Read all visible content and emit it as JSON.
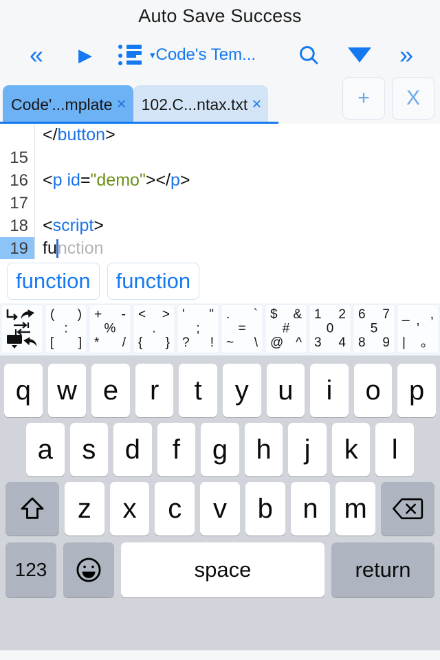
{
  "status": {
    "title": "Auto Save Success"
  },
  "toolbar": {
    "prev_label": "«",
    "run_label": "▶",
    "outline_icon": "outline-list-icon",
    "template_caret": "▾",
    "template_label": "Code's Tem...",
    "search_icon": "search-icon",
    "dropdown_label": "▼",
    "next_label": "»"
  },
  "tabs": {
    "items": [
      {
        "label": "Code'...mplate",
        "close": "×",
        "active": true
      },
      {
        "label": "102.C...ntax.txt",
        "close": "×",
        "active": false
      }
    ],
    "add_label": "+",
    "close_all_label": "X"
  },
  "editor": {
    "lines": [
      {
        "number": "",
        "tokens": [
          {
            "t": "punc",
            "v": "</"
          },
          {
            "t": "tag",
            "v": "button"
          },
          {
            "t": "punc",
            "v": ">"
          }
        ],
        "current": false
      },
      {
        "number": "15",
        "tokens": [],
        "current": false
      },
      {
        "number": "16",
        "tokens": [
          {
            "t": "punc",
            "v": "<"
          },
          {
            "t": "tag",
            "v": "p"
          },
          {
            "t": "punc",
            "v": " "
          },
          {
            "t": "attr",
            "v": "id"
          },
          {
            "t": "punc",
            "v": "="
          },
          {
            "t": "str",
            "v": "\"demo\""
          },
          {
            "t": "punc",
            "v": "></"
          },
          {
            "t": "tag",
            "v": "p"
          },
          {
            "t": "punc",
            "v": ">"
          }
        ],
        "current": false
      },
      {
        "number": "17",
        "tokens": [],
        "current": false
      },
      {
        "number": "18",
        "tokens": [
          {
            "t": "punc",
            "v": "<"
          },
          {
            "t": "tag",
            "v": "script"
          },
          {
            "t": "punc",
            "v": ">"
          }
        ],
        "current": false
      },
      {
        "number": "19",
        "tokens": [
          {
            "t": "punc",
            "v": "fu"
          },
          {
            "t": "caret",
            "v": ""
          },
          {
            "t": "ghost",
            "v": "nction"
          }
        ],
        "current": true
      }
    ]
  },
  "autocomplete": {
    "suggestions": [
      "function",
      "function"
    ]
  },
  "symbolbar": {
    "keys": [
      {
        "icons": true,
        "tl": "newline-indent-icon",
        "tr": "undo-icon",
        "mm": "tab-indent-icon",
        "bl": "hide-keyboard-icon",
        "br": "redo-icon"
      },
      {
        "tl": "(",
        "tr": ")",
        "mm": ":",
        "bl": "[",
        "br": "]"
      },
      {
        "tl": "+",
        "tr": "-",
        "mm": "%",
        "bl": "*",
        "br": "/"
      },
      {
        "tl": "<",
        "tr": ">",
        "mm": ".",
        "bl": "{",
        "br": "}"
      },
      {
        "tl": "'",
        "tr": "\"",
        "mm": ";",
        "bl": "?",
        "br": "!"
      },
      {
        "tl": ".",
        "tr": "`",
        "mm": "=",
        "bl": "~",
        "br": "\\"
      },
      {
        "tl": "$",
        "tr": "&",
        "mm": "#",
        "bl": "@",
        "br": "^"
      },
      {
        "tl": "1",
        "tr": "2",
        "mm": "0",
        "bl": "3",
        "br": "4"
      },
      {
        "tl": "6",
        "tr": "7",
        "mm": "5",
        "bl": "8",
        "br": "9"
      },
      {
        "tl": "_",
        "tr": ",",
        "mm": "’",
        "bl": "|",
        "br": "。"
      }
    ]
  },
  "keyboard": {
    "row1": [
      "q",
      "w",
      "e",
      "r",
      "t",
      "y",
      "u",
      "i",
      "o",
      "p"
    ],
    "row2": [
      "a",
      "s",
      "d",
      "f",
      "g",
      "h",
      "j",
      "k",
      "l"
    ],
    "row3": [
      "z",
      "x",
      "c",
      "v",
      "b",
      "n",
      "m"
    ],
    "shift_icon": "shift-arrow-icon",
    "backspace_icon": "backspace-icon",
    "numbers_label": "123",
    "emoji_icon": "emoji-smiley-icon",
    "space_label": "space",
    "return_label": "return"
  },
  "colors": {
    "accent": "#1479f0",
    "tab_active_bg": "#6cb2f5",
    "tab_inactive_bg": "#d3e4f6",
    "keyboard_bg": "#d1d5db",
    "key_dark": "#aeb5c0",
    "string_token": "#6c8f16",
    "tag_token": "#1a73e8",
    "ghost_text": "#b2b2b2",
    "current_line_gutter": "#8cc3f9"
  }
}
